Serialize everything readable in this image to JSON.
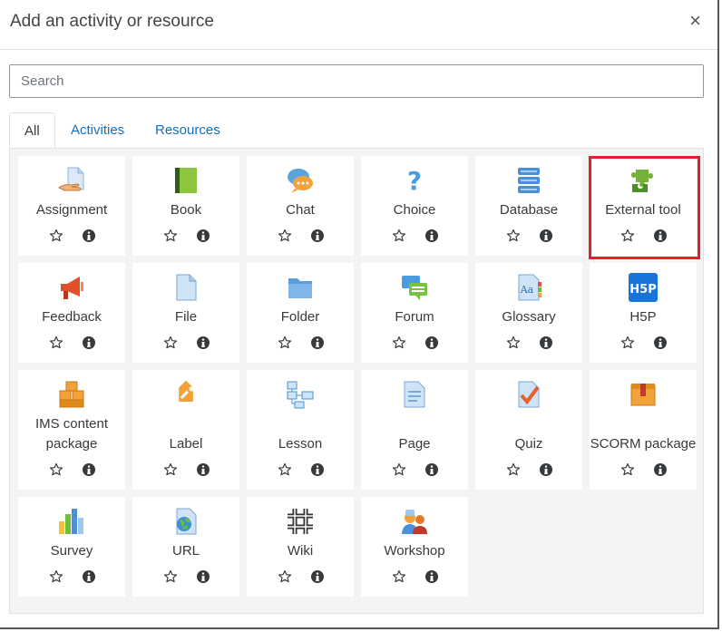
{
  "modal": {
    "title": "Add an activity or resource",
    "close_label": "×"
  },
  "search": {
    "placeholder": "Search",
    "value": ""
  },
  "tabs": [
    {
      "label": "All",
      "active": true
    },
    {
      "label": "Activities",
      "active": false
    },
    {
      "label": "Resources",
      "active": false
    }
  ],
  "items": [
    {
      "label": "Assignment",
      "icon": "assignment-icon"
    },
    {
      "label": "Book",
      "icon": "book-icon"
    },
    {
      "label": "Chat",
      "icon": "chat-icon"
    },
    {
      "label": "Choice",
      "icon": "choice-icon"
    },
    {
      "label": "Database",
      "icon": "database-icon"
    },
    {
      "label": "External tool",
      "icon": "external-tool-icon"
    },
    {
      "label": "Feedback",
      "icon": "feedback-icon"
    },
    {
      "label": "File",
      "icon": "file-icon"
    },
    {
      "label": "Folder",
      "icon": "folder-icon"
    },
    {
      "label": "Forum",
      "icon": "forum-icon"
    },
    {
      "label": "Glossary",
      "icon": "glossary-icon"
    },
    {
      "label": "H5P",
      "icon": "h5p-icon"
    },
    {
      "label": "IMS content package",
      "icon": "ims-content-package-icon"
    },
    {
      "label": "Label",
      "icon": "label-icon"
    },
    {
      "label": "Lesson",
      "icon": "lesson-icon"
    },
    {
      "label": "Page",
      "icon": "page-icon"
    },
    {
      "label": "Quiz",
      "icon": "quiz-icon"
    },
    {
      "label": "SCORM package",
      "icon": "scorm-package-icon"
    },
    {
      "label": "Survey",
      "icon": "survey-icon"
    },
    {
      "label": "URL",
      "icon": "url-icon"
    },
    {
      "label": "Wiki",
      "icon": "wiki-icon"
    },
    {
      "label": "Workshop",
      "icon": "workshop-icon"
    }
  ],
  "icons": {
    "star": "star-outline-icon",
    "info": "info-icon"
  },
  "colors": {
    "link": "#0f6fc5",
    "highlight": "#e0202c",
    "panel_bg": "#f4f4f4"
  }
}
